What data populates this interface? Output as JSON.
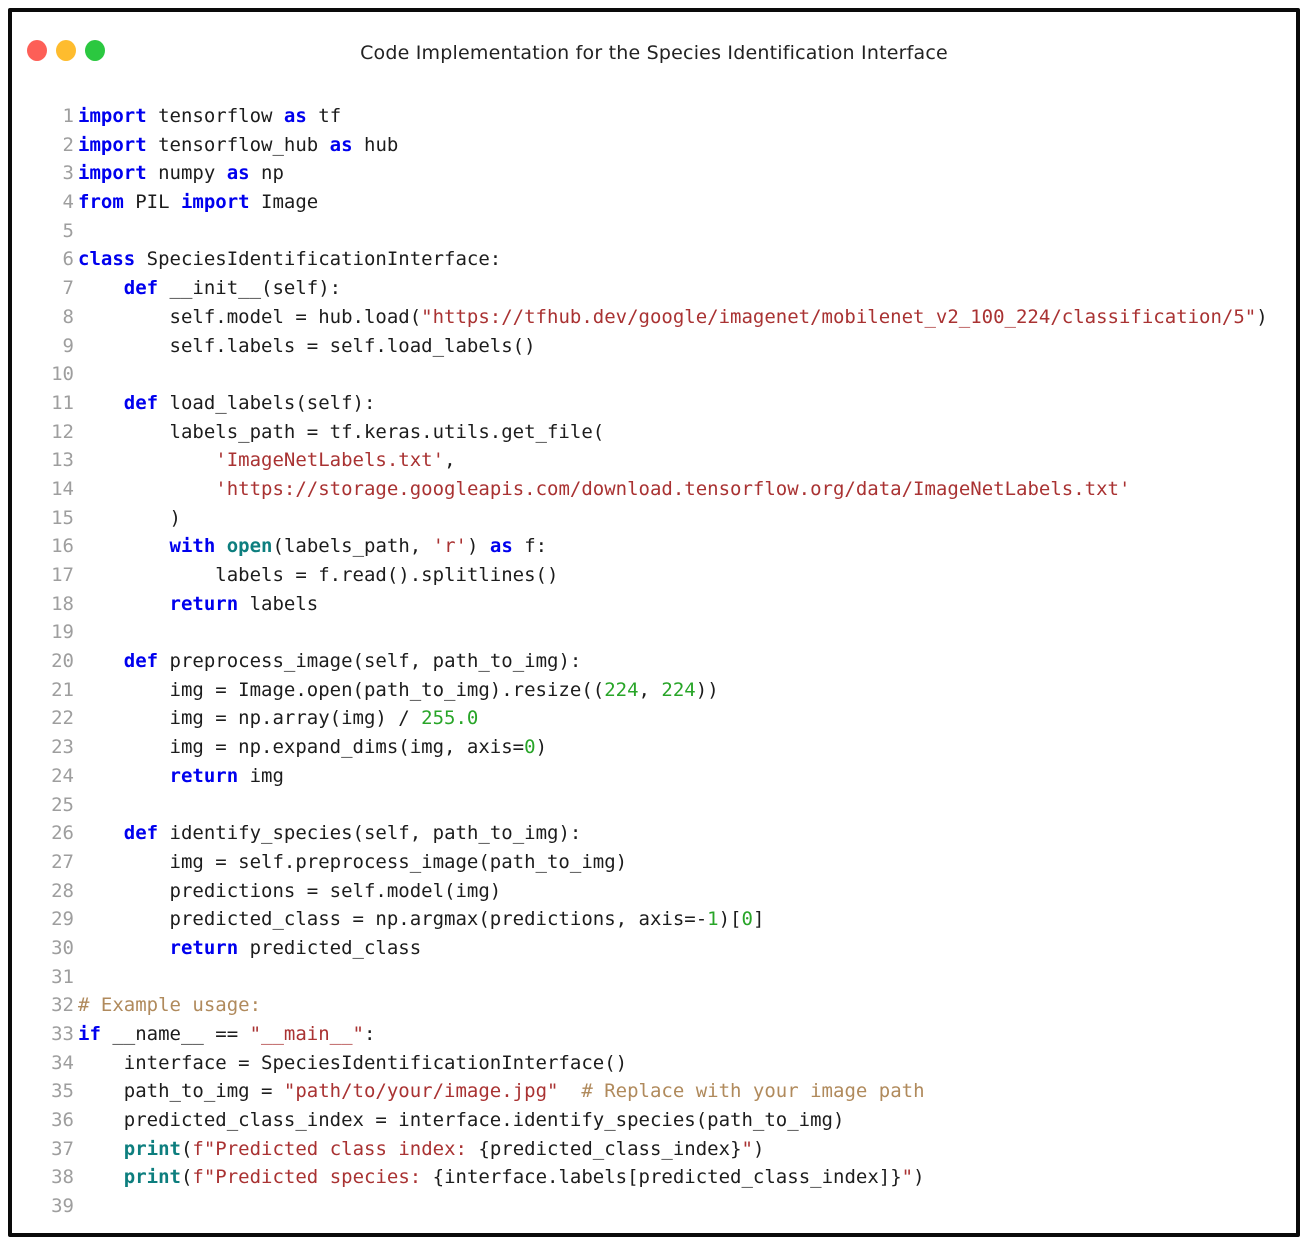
{
  "window": {
    "title": "Code Implementation for the Species Identification Interface",
    "traffic_lights": [
      {
        "name": "close",
        "color": "#fd5f57"
      },
      {
        "name": "minimize",
        "color": "#febc2e"
      },
      {
        "name": "zoom",
        "color": "#2bc840"
      }
    ]
  },
  "code": {
    "colors": {
      "keyword": "#0000ee",
      "builtin": "#0d7e7e",
      "string": "#a93232",
      "comment": "#b08a5c",
      "number": "#28a528",
      "plain": "#1c1c1c",
      "linenum": "#9e9e9e"
    },
    "lines": [
      {
        "n": 1,
        "t": [
          [
            "k",
            "import"
          ],
          [
            "p",
            " tensorflow "
          ],
          [
            "k",
            "as"
          ],
          [
            "p",
            " tf"
          ]
        ]
      },
      {
        "n": 2,
        "t": [
          [
            "k",
            "import"
          ],
          [
            "p",
            " tensorflow_hub "
          ],
          [
            "k",
            "as"
          ],
          [
            "p",
            " hub"
          ]
        ]
      },
      {
        "n": 3,
        "t": [
          [
            "k",
            "import"
          ],
          [
            "p",
            " numpy "
          ],
          [
            "k",
            "as"
          ],
          [
            "p",
            " np"
          ]
        ]
      },
      {
        "n": 4,
        "t": [
          [
            "k",
            "from"
          ],
          [
            "p",
            " PIL "
          ],
          [
            "k",
            "import"
          ],
          [
            "p",
            " Image"
          ]
        ]
      },
      {
        "n": 5,
        "t": []
      },
      {
        "n": 6,
        "t": [
          [
            "k",
            "class"
          ],
          [
            "p",
            " SpeciesIdentificationInterface:"
          ]
        ]
      },
      {
        "n": 7,
        "t": [
          [
            "p",
            "    "
          ],
          [
            "k",
            "def"
          ],
          [
            "p",
            " __init__(self):"
          ]
        ]
      },
      {
        "n": 8,
        "t": [
          [
            "p",
            "        self.model = hub.load("
          ],
          [
            "s",
            "\"https://tfhub.dev/google/imagenet/mobilenet_v2_100_224/classification/5\""
          ],
          [
            "p",
            ")"
          ]
        ]
      },
      {
        "n": 9,
        "t": [
          [
            "p",
            "        self.labels = self.load_labels()"
          ]
        ]
      },
      {
        "n": 10,
        "t": []
      },
      {
        "n": 11,
        "t": [
          [
            "p",
            "    "
          ],
          [
            "k",
            "def"
          ],
          [
            "p",
            " load_labels(self):"
          ]
        ]
      },
      {
        "n": 12,
        "t": [
          [
            "p",
            "        labels_path = tf.keras.utils.get_file("
          ]
        ]
      },
      {
        "n": 13,
        "t": [
          [
            "p",
            "            "
          ],
          [
            "s",
            "'ImageNetLabels.txt'"
          ],
          [
            "p",
            ","
          ]
        ]
      },
      {
        "n": 14,
        "t": [
          [
            "p",
            "            "
          ],
          [
            "s",
            "'https://storage.googleapis.com/download.tensorflow.org/data/ImageNetLabels.txt'"
          ]
        ]
      },
      {
        "n": 15,
        "t": [
          [
            "p",
            "        )"
          ]
        ]
      },
      {
        "n": 16,
        "t": [
          [
            "p",
            "        "
          ],
          [
            "k",
            "with"
          ],
          [
            "p",
            " "
          ],
          [
            "b",
            "open"
          ],
          [
            "p",
            "(labels_path, "
          ],
          [
            "s",
            "'r'"
          ],
          [
            "p",
            ") "
          ],
          [
            "k",
            "as"
          ],
          [
            "p",
            " f:"
          ]
        ]
      },
      {
        "n": 17,
        "t": [
          [
            "p",
            "            labels = f.read().splitlines()"
          ]
        ]
      },
      {
        "n": 18,
        "t": [
          [
            "p",
            "        "
          ],
          [
            "k",
            "return"
          ],
          [
            "p",
            " labels"
          ]
        ]
      },
      {
        "n": 19,
        "t": []
      },
      {
        "n": 20,
        "t": [
          [
            "p",
            "    "
          ],
          [
            "k",
            "def"
          ],
          [
            "p",
            " preprocess_image(self, path_to_img):"
          ]
        ]
      },
      {
        "n": 21,
        "t": [
          [
            "p",
            "        img = Image.open(path_to_img).resize(("
          ],
          [
            "n",
            "224"
          ],
          [
            "p",
            ", "
          ],
          [
            "n",
            "224"
          ],
          [
            "p",
            "))"
          ]
        ]
      },
      {
        "n": 22,
        "t": [
          [
            "p",
            "        img = np.array(img) / "
          ],
          [
            "n",
            "255.0"
          ]
        ]
      },
      {
        "n": 23,
        "t": [
          [
            "p",
            "        img = np.expand_dims(img, axis="
          ],
          [
            "n",
            "0"
          ],
          [
            "p",
            ")"
          ]
        ]
      },
      {
        "n": 24,
        "t": [
          [
            "p",
            "        "
          ],
          [
            "k",
            "return"
          ],
          [
            "p",
            " img"
          ]
        ]
      },
      {
        "n": 25,
        "t": []
      },
      {
        "n": 26,
        "t": [
          [
            "p",
            "    "
          ],
          [
            "k",
            "def"
          ],
          [
            "p",
            " identify_species(self, path_to_img):"
          ]
        ]
      },
      {
        "n": 27,
        "t": [
          [
            "p",
            "        img = self.preprocess_image(path_to_img)"
          ]
        ]
      },
      {
        "n": 28,
        "t": [
          [
            "p",
            "        predictions = self.model(img)"
          ]
        ]
      },
      {
        "n": 29,
        "t": [
          [
            "p",
            "        predicted_class = np.argmax(predictions, axis=-"
          ],
          [
            "n",
            "1"
          ],
          [
            "p",
            ")["
          ],
          [
            "n",
            "0"
          ],
          [
            "p",
            "]"
          ]
        ]
      },
      {
        "n": 30,
        "t": [
          [
            "p",
            "        "
          ],
          [
            "k",
            "return"
          ],
          [
            "p",
            " predicted_class"
          ]
        ]
      },
      {
        "n": 31,
        "t": []
      },
      {
        "n": 32,
        "t": [
          [
            "c",
            "# Example usage:"
          ]
        ]
      },
      {
        "n": 33,
        "t": [
          [
            "k",
            "if"
          ],
          [
            "p",
            " __name__ == "
          ],
          [
            "s",
            "\"__main__\""
          ],
          [
            "p",
            ":"
          ]
        ]
      },
      {
        "n": 34,
        "t": [
          [
            "p",
            "    interface = SpeciesIdentificationInterface()"
          ]
        ]
      },
      {
        "n": 35,
        "t": [
          [
            "p",
            "    path_to_img = "
          ],
          [
            "s",
            "\"path/to/your/image.jpg\""
          ],
          [
            "p",
            "  "
          ],
          [
            "c",
            "# Replace with your image path"
          ]
        ]
      },
      {
        "n": 36,
        "t": [
          [
            "p",
            "    predicted_class_index = interface.identify_species(path_to_img)"
          ]
        ]
      },
      {
        "n": 37,
        "t": [
          [
            "p",
            "    "
          ],
          [
            "b",
            "print"
          ],
          [
            "p",
            "("
          ],
          [
            "s",
            "f\"Predicted class index: "
          ],
          [
            "p",
            "{predicted_class_index}"
          ],
          [
            "s",
            "\""
          ],
          [
            "p",
            ")"
          ]
        ]
      },
      {
        "n": 38,
        "t": [
          [
            "p",
            "    "
          ],
          [
            "b",
            "print"
          ],
          [
            "p",
            "("
          ],
          [
            "s",
            "f\"Predicted species: "
          ],
          [
            "p",
            "{interface.labels[predicted_class_index]}"
          ],
          [
            "s",
            "\""
          ],
          [
            "p",
            ")"
          ]
        ]
      },
      {
        "n": 39,
        "t": []
      }
    ]
  }
}
